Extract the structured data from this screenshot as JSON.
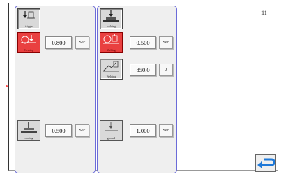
{
  "page_number": "11",
  "left_panel": {
    "trigger": {
      "label": "trigger"
    },
    "overtop": {
      "label": "Overtop",
      "value": "0.800",
      "unit": "Sec"
    },
    "cooling": {
      "label": "cooling",
      "value": "0.500",
      "unit": "Sec"
    }
  },
  "right_panel": {
    "welding": {
      "label": "welding"
    },
    "melting": {
      "label": "Melting",
      "value": "0.500",
      "unit": "Sec"
    },
    "energy": {
      "label": "Welding",
      "value": "850.0",
      "unit": "J"
    },
    "ground": {
      "label": "ground",
      "value": "1.000",
      "unit": "Sec"
    }
  },
  "colors": {
    "panel_border": "#6b6bd8",
    "active_red": "#e94040",
    "back_arrow": "#1e78d8"
  },
  "icons": {
    "trigger": "press-down-icon",
    "overtop": "overtop-icon",
    "cooling": "cooling-icon",
    "welding": "welding-head-icon",
    "melting": "melting-icon",
    "energy": "energy-curve-icon",
    "ground": "ground-icon",
    "back": "return-arrow-icon"
  }
}
